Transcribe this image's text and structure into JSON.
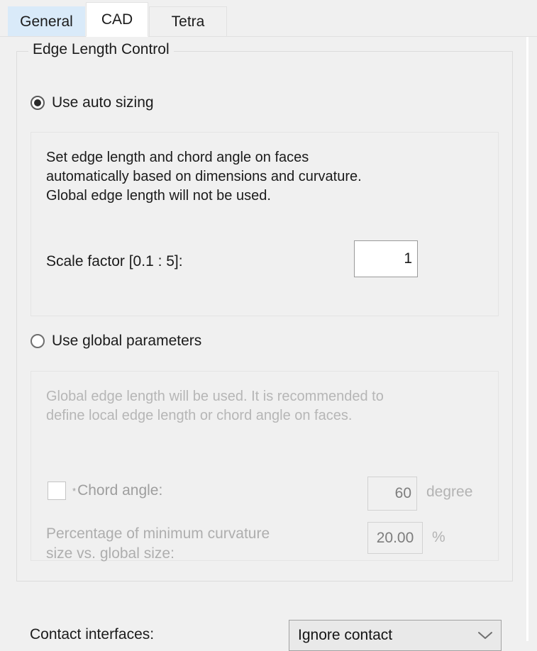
{
  "tabs": [
    {
      "label": "General",
      "state": "hover"
    },
    {
      "label": "CAD",
      "state": "active"
    },
    {
      "label": "Tetra",
      "state": "inactive"
    }
  ],
  "group": {
    "title": "Edge Length Control"
  },
  "auto_sizing": {
    "radio_label": "Use auto sizing",
    "selected": true,
    "description": "Set edge length and chord angle on faces\nautomatically based on dimensions and curvature.\nGlobal edge length will not be used.",
    "scale_factor": {
      "label": "Scale factor [0.1 : 5]:",
      "value": "1"
    }
  },
  "global_parameters": {
    "radio_label": "Use global parameters",
    "selected": false,
    "description": "Global edge length will be used. It is recommended to\ndefine local edge length or chord angle on faces.",
    "chord_angle": {
      "asterisk": "*",
      "label": "Chord angle:",
      "checked": false,
      "value": "60",
      "unit": "degree"
    },
    "min_curvature": {
      "label": "Percentage of minimum curvature\nsize vs. global size:",
      "value": "20.00",
      "unit": "%"
    }
  },
  "contact": {
    "label": "Contact interfaces:",
    "value": "Ignore contact",
    "arrow_icon": "chevron-down-icon"
  },
  "colors": {
    "panel": "#f0f0f0",
    "tab_hover": "#d9eaf9",
    "tab_active": "#ffffff",
    "border": "#dcdcdc",
    "disabled_text": "#b3b3b3",
    "text": "#1b1b1b"
  }
}
